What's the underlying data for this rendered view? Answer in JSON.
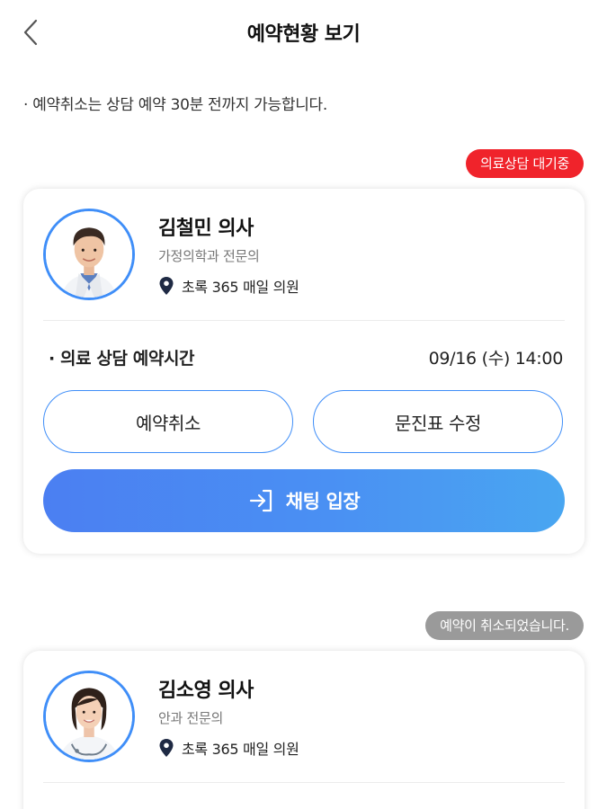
{
  "header": {
    "title": "예약현황 보기",
    "back_icon": "chevron-left-icon"
  },
  "notice": "· 예약취소는 상담 예약 30분 전까지 가능합니다.",
  "colors": {
    "accent": "#3f8ef8",
    "waiting_badge": "#f0232b",
    "cancelled_badge": "#9a9a9a",
    "button_gradient_start": "#4b7ff2",
    "button_gradient_end": "#49a6f1"
  },
  "reservations": [
    {
      "status": "의료상담 대기중",
      "doctor_name": "김철민 의사",
      "department": "가정의학과 전문의",
      "clinic": "초록 365 매일 의원",
      "time_label": "· 의료 상담 예약시간",
      "time_value": "09/16 (수) 14:00",
      "cancel_label": "예약취소",
      "edit_label": "문진표 수정",
      "chat_label": "채팅 입장",
      "chat_icon": "enter-icon",
      "location_icon": "location-pin-icon"
    },
    {
      "status": "예약이 취소되었습니다.",
      "doctor_name": "김소영 의사",
      "department": "안과 전문의",
      "clinic": "초록 365 매일 의원",
      "location_icon": "location-pin-icon"
    }
  ]
}
